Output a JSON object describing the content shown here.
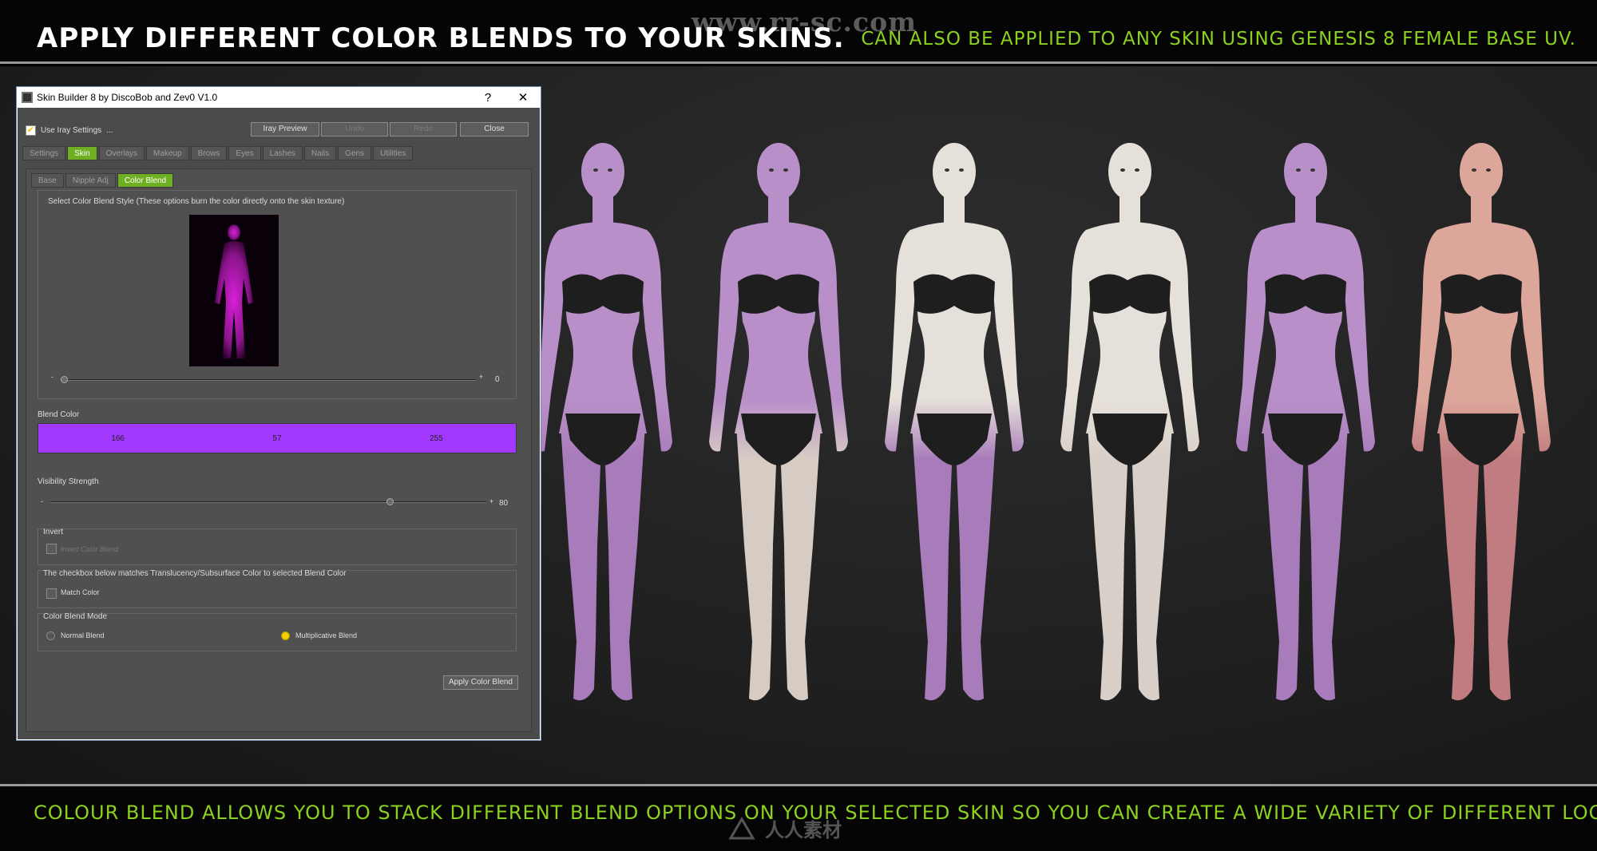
{
  "banner": {
    "headline": "APPLY DIFFERENT COLOR BLENDS TO YOUR SKINS.",
    "subheadline": "CAN ALSO BE APPLIED TO ANY SKIN USING GENESIS 8 FEMALE BASE UV.",
    "watermark_url": "www.rr-sc.com"
  },
  "footer": {
    "text": "COLOUR BLEND ALLOWS YOU TO STACK DIFFERENT BLEND OPTIONS ON YOUR SELECTED SKIN SO YOU CAN CREATE A WIDE VARIETY OF DIFFERENT LOOKS.",
    "logo_text": "人人素材"
  },
  "colors": {
    "accent_green": "#8bd11e",
    "active_tab": "#6fb023",
    "blend_color": "#a339ff",
    "radio_selected": "#f3d000"
  },
  "figures": [
    {
      "upper": "#b98fc9",
      "lower": "#a87cba"
    },
    {
      "upper": "#b98fc9",
      "lower": "#d6ccc4"
    },
    {
      "upper": "#e6e0da",
      "lower": "#a87cba"
    },
    {
      "upper": "#e6e0da",
      "lower": "#d8d0c8"
    },
    {
      "upper": "#b98fc9",
      "lower": "#a87cba"
    },
    {
      "upper": "#dca69a",
      "lower": "#c07c80"
    }
  ],
  "dialog": {
    "title": "Skin Builder 8 by DiscoBob and Zev0 V1.0",
    "help": "?",
    "close": "✕",
    "iray_settings_label": "Use Iray Settings",
    "iray_settings_dots": "...",
    "buttons": {
      "iray_preview": "Iray Preview",
      "undo": "Undo",
      "redo": "Redo",
      "close": "Close"
    },
    "tabs": [
      "Settings",
      "Skin",
      "Overlays",
      "Makeup",
      "Brows",
      "Eyes",
      "Lashes",
      "Nails",
      "Gens",
      "Utilities"
    ],
    "subtabs": [
      "Base",
      "Nipple Adj",
      "Color Blend"
    ],
    "style_group_label": "Select Color Blend Style (These options burn the color directly onto the skin texture)",
    "style_slider_value": "0",
    "blend_color_label": "Blend Color",
    "blend_rgb": [
      "166",
      "57",
      "255"
    ],
    "visibility_label": "Visibility Strength",
    "visibility_value": "80",
    "visibility_fraction": 0.78,
    "invert_group_label": "Invert",
    "invert_checkbox_label": "Invert Color Blend",
    "match_note": "The checkbox below matches Translucency/Subsurface Color to selected Blend Color",
    "match_checkbox_label": "Match Color",
    "mode_group_label": "Color Blend Mode",
    "mode_normal": "Normal Blend",
    "mode_multiplicative": "Multiplicative Blend",
    "apply_button": "Apply Color Blend"
  }
}
